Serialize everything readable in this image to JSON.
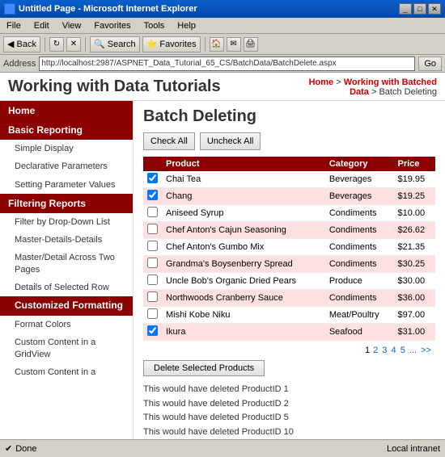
{
  "window": {
    "title": "Untitled Page - Microsoft Internet Explorer",
    "icon": "ie-icon"
  },
  "menubar": {
    "items": [
      "File",
      "Edit",
      "View",
      "Favorites",
      "Tools",
      "Help"
    ]
  },
  "toolbar": {
    "back_label": "Back",
    "search_label": "Search",
    "favorites_label": "Favorites"
  },
  "address": {
    "label": "Address",
    "url": "http://localhost:2987/ASPNET_Data_Tutorial_65_CS/BatchData/BatchDelete.aspx",
    "go_label": "Go"
  },
  "header": {
    "site_title": "Working with Data Tutorials",
    "breadcrumb_home": "Home",
    "breadcrumb_link": "Working with Batched Data",
    "breadcrumb_current": "Batch Deleting"
  },
  "sidebar": {
    "groups": [
      {
        "id": "home",
        "label": "Home",
        "type": "header-item"
      },
      {
        "id": "basic-reporting",
        "label": "Basic Reporting",
        "type": "group"
      },
      {
        "id": "simple-display",
        "label": "Simple Display",
        "type": "item",
        "group": "basic-reporting"
      },
      {
        "id": "declarative-parameters",
        "label": "Declarative Parameters",
        "type": "item",
        "group": "basic-reporting"
      },
      {
        "id": "setting-parameter-values",
        "label": "Setting Parameter Values",
        "type": "item",
        "group": "basic-reporting"
      },
      {
        "id": "filtering-reports",
        "label": "Filtering Reports",
        "type": "group"
      },
      {
        "id": "filter-by-dropdown",
        "label": "Filter by Drop-Down List",
        "type": "item",
        "group": "filtering-reports"
      },
      {
        "id": "master-details-details",
        "label": "Master-Details-Details",
        "type": "item",
        "group": "filtering-reports"
      },
      {
        "id": "master-detail-across",
        "label": "Master/Detail Across Two Pages",
        "type": "item",
        "group": "filtering-reports"
      },
      {
        "id": "details-selected-row",
        "label": "Details of Selected Row",
        "type": "item",
        "group": "filtering-reports"
      },
      {
        "id": "customized-formatting",
        "label": "Customized Formatting",
        "type": "group",
        "active": true
      },
      {
        "id": "format-colors",
        "label": "Format Colors",
        "type": "item",
        "group": "customized-formatting"
      },
      {
        "id": "custom-content-gridview",
        "label": "Custom Content in a GridView",
        "type": "item",
        "group": "customized-formatting"
      },
      {
        "id": "custom-content-2",
        "label": "Custom Content in a",
        "type": "item",
        "group": "customized-formatting"
      }
    ]
  },
  "main": {
    "page_title": "Batch Deleting",
    "check_all_label": "Check All",
    "uncheck_all_label": "Uncheck All",
    "table": {
      "headers": [
        "",
        "Product",
        "Category",
        "Price"
      ],
      "rows": [
        {
          "checked": true,
          "product": "Chai Tea",
          "category": "Beverages",
          "price": "$19.95",
          "highlighted": false
        },
        {
          "checked": true,
          "product": "Chang",
          "category": "Beverages",
          "price": "$19.25",
          "highlighted": true
        },
        {
          "checked": false,
          "product": "Aniseed Syrup",
          "category": "Condiments",
          "price": "$10.00",
          "highlighted": false
        },
        {
          "checked": false,
          "product": "Chef Anton's Cajun Seasoning",
          "category": "Condiments",
          "price": "$26.62",
          "highlighted": true
        },
        {
          "checked": false,
          "product": "Chef Anton's Gumbo Mix",
          "category": "Condiments",
          "price": "$21.35",
          "highlighted": false
        },
        {
          "checked": false,
          "product": "Grandma's Boysenberry Spread",
          "category": "Condiments",
          "price": "$30.25",
          "highlighted": true
        },
        {
          "checked": false,
          "product": "Uncle Bob's Organic Dried Pears",
          "category": "Produce",
          "price": "$30.00",
          "highlighted": false
        },
        {
          "checked": false,
          "product": "Northwoods Cranberry Sauce",
          "category": "Condiments",
          "price": "$36.00",
          "highlighted": true
        },
        {
          "checked": false,
          "product": "Mishi Kobe Niku",
          "category": "Meat/Poultry",
          "price": "$97.00",
          "highlighted": false
        },
        {
          "checked": true,
          "product": "Ikura",
          "category": "Seafood",
          "price": "$31.00",
          "highlighted": true
        }
      ]
    },
    "pagination": {
      "current": "1",
      "pages": [
        "2",
        "3",
        "4",
        "5",
        "..."
      ],
      "next": ">>",
      "prefix": "1 "
    },
    "delete_button_label": "Delete Selected Products",
    "log_messages": [
      "This would have deleted ProductID 1",
      "This would have deleted ProductID 2",
      "This would have deleted ProductID 5",
      "This would have deleted ProductID 10"
    ]
  },
  "status_bar": {
    "left": "Done",
    "right": "Local intranet"
  }
}
